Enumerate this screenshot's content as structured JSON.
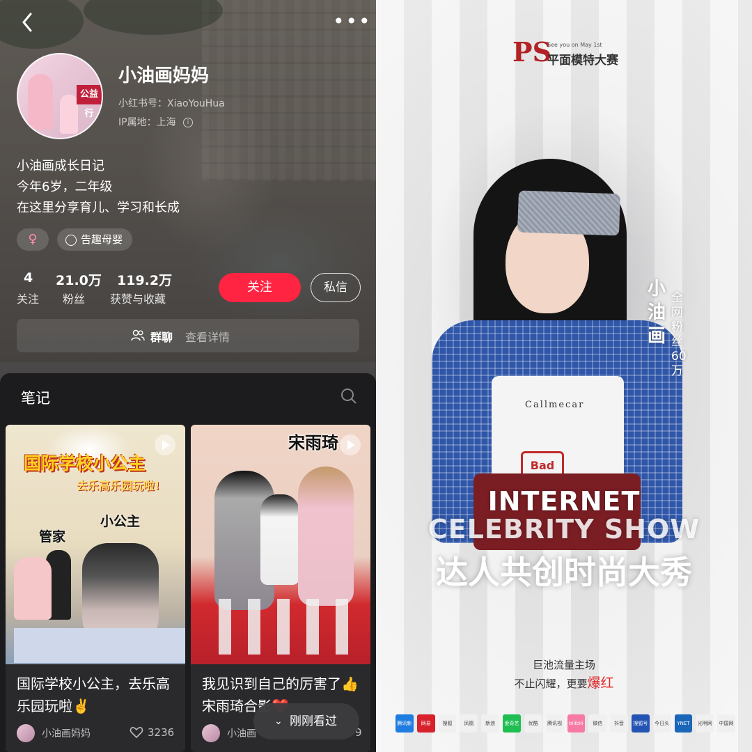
{
  "profile": {
    "name": "小油画妈妈",
    "id_label": "小红书号：XiaoYouHua",
    "ip_label": "IP属地：上海",
    "bio": [
      "小油画成长日记",
      "今年6岁，二年级",
      "在这里分享育儿、学习和长成"
    ],
    "tags": [
      {
        "icon": "female-icon",
        "label": ""
      },
      {
        "icon": "mom-icon",
        "label": "告趣母婴"
      }
    ],
    "stats": [
      {
        "value": "4",
        "label": "关注"
      },
      {
        "value": "21.0万",
        "label": "粉丝"
      },
      {
        "value": "119.2万",
        "label": "获赞与收藏"
      }
    ],
    "follow_label": "关注",
    "message_label": "私信",
    "group_label": "群聊",
    "group_detail": "查看详情"
  },
  "avatar_text": {
    "badge": "公益行"
  },
  "notes": {
    "title": "笔记",
    "cards": [
      {
        "overlay_title": "国际学校小公主",
        "overlay_sub": "去乐高乐园玩啦!",
        "tag1": "管家",
        "tag2": "小公主",
        "caption": "国际学校小公主，去乐高乐园玩啦✌️",
        "author": "小油画妈妈",
        "likes": "3236"
      },
      {
        "overlay_title": "宋雨琦",
        "caption": "我见识到自己的厉害了👍宋雨琦合影❤️",
        "author": "小油画",
        "likes": "9"
      }
    ],
    "recent_label": "刚刚看过"
  },
  "poster": {
    "brand": "PS",
    "brand_cn": "平面模特大赛",
    "brand_en": "See you on May 1st",
    "apron_text": "Callmecar",
    "apron_badge": "Bad",
    "name_vertical": "小油画",
    "fans_vertical": "全网粉丝60万",
    "show_line1": "INTERNET",
    "show_line2": "CELEBRITY SHOW",
    "show_cn": "达人共创时尚大秀",
    "slogan1": "巨池流量主场",
    "slogan2_pre": "不止闪耀，更要",
    "slogan2_hot": "爆红",
    "logos": [
      {
        "label": "腾讯新闻",
        "color": "#1f7ce0"
      },
      {
        "label": "网易",
        "color": "#d8212b"
      },
      {
        "label": "搜狐",
        "color": "#f0f0f0"
      },
      {
        "label": "凤凰",
        "color": "#f0f0f0"
      },
      {
        "label": "新浪",
        "color": "#f0f0f0"
      },
      {
        "label": "爱奇艺",
        "color": "#1ebe52"
      },
      {
        "label": "优酷",
        "color": "#f0f0f0"
      },
      {
        "label": "腾讯视频",
        "color": "#f0f0f0"
      },
      {
        "label": "bilibili",
        "color": "#f67aa5"
      },
      {
        "label": "微信",
        "color": "#f0f0f0"
      },
      {
        "label": "抖音",
        "color": "#f0f0f0"
      },
      {
        "label": "搜狐号",
        "color": "#2353b3"
      },
      {
        "label": "今日头条",
        "color": "#f0f0f0"
      },
      {
        "label": "YNET",
        "color": "#1a66b8"
      },
      {
        "label": "光明网",
        "color": "#f0f0f0"
      },
      {
        "label": "中国网",
        "color": "#f0f0f0"
      }
    ]
  },
  "colors": {
    "accent": "#ff2442",
    "dark_panel": "#1c1c1e",
    "poster_red": "#b22226"
  }
}
